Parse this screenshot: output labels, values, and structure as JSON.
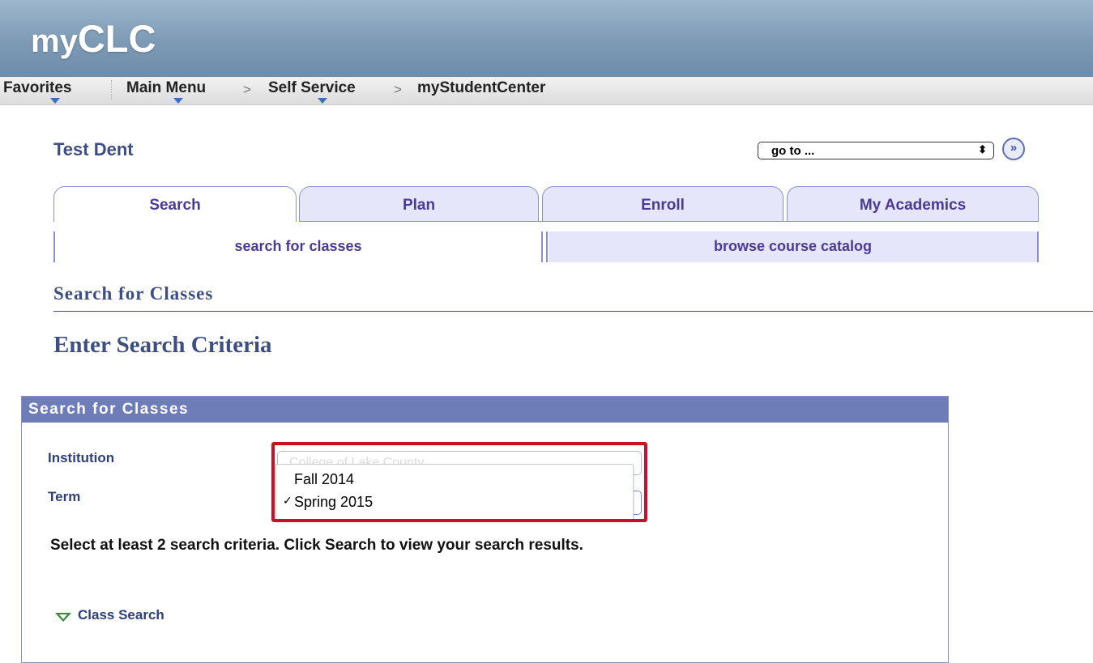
{
  "header": {
    "logo_prefix": "my",
    "logo_main": "CLC"
  },
  "nav": {
    "favorites": "Favorites",
    "main_menu": "Main Menu",
    "self_service": "Self Service",
    "current": "myStudentCenter",
    "separator": ">"
  },
  "student": {
    "name": "Test Dent"
  },
  "goto": {
    "value": "go to ...",
    "arrows": "⬍"
  },
  "tabs": [
    {
      "label": "Search",
      "active": true
    },
    {
      "label": "Plan",
      "active": false
    },
    {
      "label": "Enroll",
      "active": false
    },
    {
      "label": "My Academics",
      "active": false
    }
  ],
  "subtabs": [
    {
      "label": "search for classes",
      "active": true
    },
    {
      "label": "browse course catalog",
      "active": false
    }
  ],
  "page": {
    "title": "Search for Classes",
    "criteria_title": "Enter Search Criteria"
  },
  "panel": {
    "header": "Search for Classes",
    "institution_label": "Institution",
    "institution_value": "College of Lake County",
    "term_label": "Term",
    "term_options": [
      "Fall 2014",
      "Spring 2015"
    ],
    "term_selected": "Spring 2015",
    "check_mark": "✓",
    "instructions": "Select at least 2 search criteria. Click Search to view your search results.",
    "class_search_label": "Class Search"
  },
  "colors": {
    "header_blue": "#7d9ab5",
    "panel_header": "#6e7db8",
    "tab_text": "#4b3a93",
    "highlight_red": "#c8102e",
    "title_blue": "#3d4e85"
  }
}
